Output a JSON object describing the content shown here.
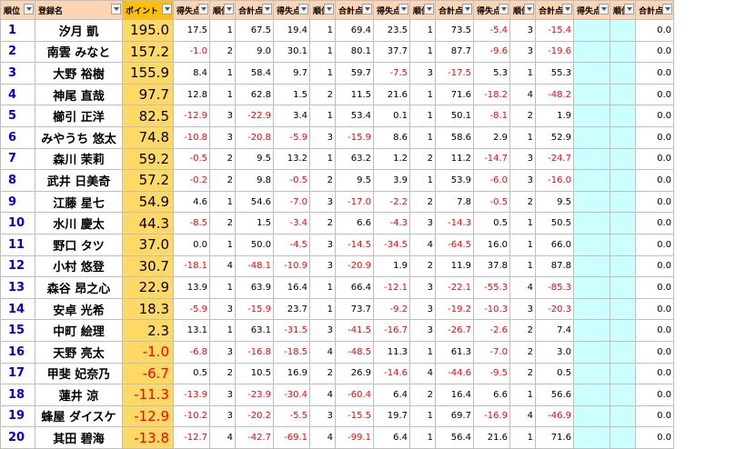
{
  "headers": {
    "rank": "順位",
    "name": "登録名",
    "points": "ポイント",
    "score": "得失点",
    "place": "順位",
    "total": "合計点"
  },
  "rows": [
    {
      "rank": "1",
      "name": "汐月 凱",
      "points": "195.0",
      "cells": [
        "17.5",
        "1",
        "67.5",
        "19.4",
        "1",
        "69.4",
        "23.5",
        "1",
        "73.5",
        "-5.4",
        "3",
        "-15.4",
        "",
        "",
        "0.0"
      ]
    },
    {
      "rank": "2",
      "name": "南雲 みなと",
      "points": "157.2",
      "cells": [
        "-1.0",
        "2",
        "9.0",
        "30.1",
        "1",
        "80.1",
        "37.7",
        "1",
        "87.7",
        "-9.6",
        "3",
        "-19.6",
        "",
        "",
        "0.0"
      ]
    },
    {
      "rank": "3",
      "name": "大野 裕樹",
      "points": "155.9",
      "cells": [
        "8.4",
        "1",
        "58.4",
        "9.7",
        "1",
        "59.7",
        "-7.5",
        "3",
        "-17.5",
        "5.3",
        "1",
        "55.3",
        "",
        "",
        "0.0"
      ]
    },
    {
      "rank": "4",
      "name": "神尾 直哉",
      "points": "97.7",
      "cells": [
        "12.8",
        "1",
        "62.8",
        "1.5",
        "2",
        "11.5",
        "21.6",
        "1",
        "71.6",
        "-18.2",
        "4",
        "-48.2",
        "",
        "",
        "0.0"
      ]
    },
    {
      "rank": "5",
      "name": "櫛引 正洋",
      "points": "82.5",
      "cells": [
        "-12.9",
        "3",
        "-22.9",
        "3.4",
        "1",
        "53.4",
        "0.1",
        "1",
        "50.1",
        "-8.1",
        "2",
        "1.9",
        "",
        "",
        "0.0"
      ]
    },
    {
      "rank": "6",
      "name": "みやうち 悠太",
      "points": "74.8",
      "cells": [
        "-10.8",
        "3",
        "-20.8",
        "-5.9",
        "3",
        "-15.9",
        "8.6",
        "1",
        "58.6",
        "2.9",
        "1",
        "52.9",
        "",
        "",
        "0.0"
      ]
    },
    {
      "rank": "7",
      "name": "森川 茉莉",
      "points": "59.2",
      "cells": [
        "-0.5",
        "2",
        "9.5",
        "13.2",
        "1",
        "63.2",
        "1.2",
        "2",
        "11.2",
        "-14.7",
        "3",
        "-24.7",
        "",
        "",
        "0.0"
      ]
    },
    {
      "rank": "8",
      "name": "武井 日美奇",
      "points": "57.2",
      "cells": [
        "-0.2",
        "2",
        "9.8",
        "-0.5",
        "2",
        "9.5",
        "3.9",
        "1",
        "53.9",
        "-6.0",
        "3",
        "-16.0",
        "",
        "",
        "0.0"
      ]
    },
    {
      "rank": "9",
      "name": "江藤 星七",
      "points": "54.9",
      "cells": [
        "4.6",
        "1",
        "54.6",
        "-7.0",
        "3",
        "-17.0",
        "-2.2",
        "2",
        "7.8",
        "-0.5",
        "2",
        "9.5",
        "",
        "",
        "0.0"
      ]
    },
    {
      "rank": "10",
      "name": "水川 慶太",
      "points": "44.3",
      "cells": [
        "-8.5",
        "2",
        "1.5",
        "-3.4",
        "2",
        "6.6",
        "-4.3",
        "3",
        "-14.3",
        "0.5",
        "1",
        "50.5",
        "",
        "",
        "0.0"
      ]
    },
    {
      "rank": "11",
      "name": "野口 タツ",
      "points": "37.0",
      "cells": [
        "0.0",
        "1",
        "50.0",
        "-4.5",
        "3",
        "-14.5",
        "-34.5",
        "4",
        "-64.5",
        "16.0",
        "1",
        "66.0",
        "",
        "",
        "0.0"
      ]
    },
    {
      "rank": "12",
      "name": "小村 悠登",
      "points": "30.7",
      "cells": [
        "-18.1",
        "4",
        "-48.1",
        "-10.9",
        "3",
        "-20.9",
        "1.9",
        "2",
        "11.9",
        "37.8",
        "1",
        "87.8",
        "",
        "",
        "0.0"
      ]
    },
    {
      "rank": "13",
      "name": "森谷 昂之心",
      "points": "22.9",
      "cells": [
        "13.9",
        "1",
        "63.9",
        "16.4",
        "1",
        "66.4",
        "-12.1",
        "3",
        "-22.1",
        "-55.3",
        "4",
        "-85.3",
        "",
        "",
        "0.0"
      ]
    },
    {
      "rank": "14",
      "name": "安卓 光希",
      "points": "18.3",
      "cells": [
        "-5.9",
        "3",
        "-15.9",
        "23.7",
        "1",
        "73.7",
        "-9.2",
        "3",
        "-19.2",
        "-10.3",
        "3",
        "-20.3",
        "",
        "",
        "0.0"
      ]
    },
    {
      "rank": "15",
      "name": "中町 絵理",
      "points": "2.3",
      "cells": [
        "13.1",
        "1",
        "63.1",
        "-31.5",
        "3",
        "-41.5",
        "-16.7",
        "3",
        "-26.7",
        "-2.6",
        "2",
        "7.4",
        "",
        "",
        "0.0"
      ]
    },
    {
      "rank": "16",
      "name": "天野 亮太",
      "points": "-1.0",
      "cells": [
        "-6.8",
        "3",
        "-16.8",
        "-18.5",
        "4",
        "-48.5",
        "11.3",
        "1",
        "61.3",
        "-7.0",
        "2",
        "3.0",
        "",
        "",
        "0.0"
      ]
    },
    {
      "rank": "17",
      "name": "甲斐 妃奈乃",
      "points": "-6.7",
      "cells": [
        "0.5",
        "2",
        "10.5",
        "16.9",
        "2",
        "26.9",
        "-14.6",
        "4",
        "-44.6",
        "-9.5",
        "2",
        "0.5",
        "",
        "",
        "0.0"
      ]
    },
    {
      "rank": "18",
      "name": "蓮井 涼",
      "points": "-11.3",
      "cells": [
        "-13.9",
        "3",
        "-23.9",
        "-30.4",
        "4",
        "-60.4",
        "6.4",
        "2",
        "16.4",
        "6.6",
        "1",
        "56.6",
        "",
        "",
        "0.0"
      ]
    },
    {
      "rank": "19",
      "name": "蜂屋 ダイスケ",
      "points": "-12.9",
      "cells": [
        "-10.2",
        "3",
        "-20.2",
        "-5.5",
        "3",
        "-15.5",
        "19.7",
        "1",
        "69.7",
        "-16.9",
        "4",
        "-46.9",
        "",
        "",
        "0.0"
      ]
    },
    {
      "rank": "20",
      "name": "其田 碧海",
      "points": "-13.8",
      "cells": [
        "-12.7",
        "4",
        "-42.7",
        "-69.1",
        "4",
        "-99.1",
        "6.4",
        "1",
        "56.4",
        "21.6",
        "1",
        "71.6",
        "",
        "",
        "0.0"
      ]
    }
  ],
  "colors": {
    "header_bg": "#fcd5b4",
    "points_header_bg": "#ffc000",
    "points_bg": "#ffd966",
    "rank_color": "#0000cc",
    "negative_color": "#ff0000",
    "empty_cell_bg": "#ccffff"
  }
}
